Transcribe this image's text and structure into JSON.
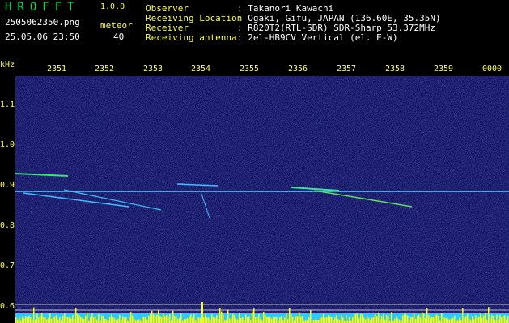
{
  "app": {
    "logo": "HROFFT",
    "version": "1.0.0",
    "file_name": "2505062350.png",
    "datetime": "25.05.06 23:50",
    "meteor_label": "meteor",
    "meteor_count": "40"
  },
  "info": {
    "rows": [
      {
        "label": "Observer",
        "value": ": Takanori Kawachi"
      },
      {
        "label": "Receiving Location",
        "value": ": Ogaki, Gifu, JAPAN (136.60E, 35.35N)"
      },
      {
        "label": "Receiver",
        "value": ": R820T2(RTL-SDR) SDR-Sharp 53.372MHz"
      },
      {
        "label": "Receiving antenna",
        "value": ": 2el-HB9CV Vertical (el. E-W)"
      }
    ]
  },
  "axis": {
    "y_unit": "kHz",
    "y_ticks": [
      "1.1",
      "1.0",
      "0.9",
      "0.8",
      "0.7",
      "0.6"
    ],
    "x_ticks": [
      "2351",
      "2352",
      "2353",
      "2354",
      "2355",
      "2356",
      "2357",
      "2358",
      "2359",
      "0000"
    ]
  },
  "colors": {
    "background": "#0b0b55",
    "signal": "#30c8ff",
    "noise_bar": "#ffff00",
    "label": "#ffff60"
  }
}
